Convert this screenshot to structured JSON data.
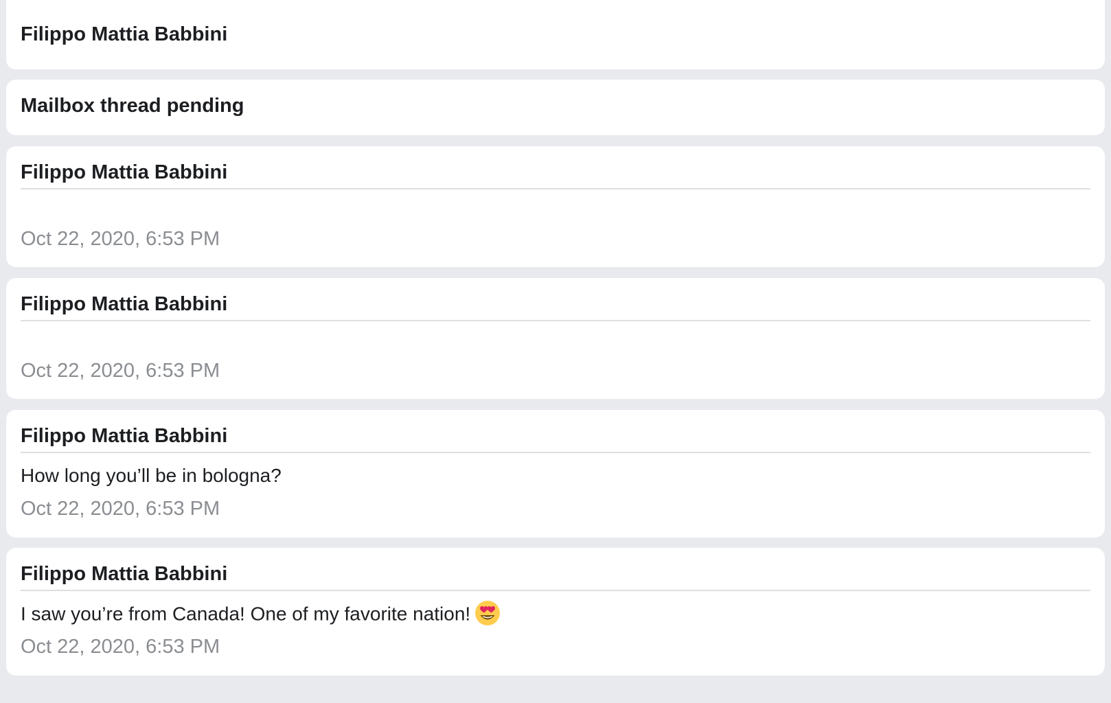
{
  "cards": [
    {
      "title": "Filippo Mattia Babbini"
    },
    {
      "title": "Mailbox thread pending"
    },
    {
      "sender": "Filippo Mattia Babbini",
      "message": "",
      "time": "Oct 22, 2020, 6:53 PM"
    },
    {
      "sender": "Filippo Mattia Babbini",
      "message": "",
      "time": "Oct 22, 2020, 6:53 PM"
    },
    {
      "sender": "Filippo Mattia Babbini",
      "message": "How long you’ll be in bologna?",
      "time": "Oct 22, 2020, 6:53 PM"
    },
    {
      "sender": "Filippo Mattia Babbini",
      "message": "I saw you’re from Canada! One of my favorite nation!",
      "emoji": "heart-eyes-emoji",
      "time": "Oct 22, 2020, 6:53 PM"
    }
  ],
  "colors": {
    "background": "#e9eaee",
    "card": "#ffffff",
    "text": "#1c1e21",
    "timestamp": "#8a8d91",
    "divider": "#dddfe2",
    "emoji_face": "#ffcc4d",
    "emoji_heart": "#e0245e"
  }
}
